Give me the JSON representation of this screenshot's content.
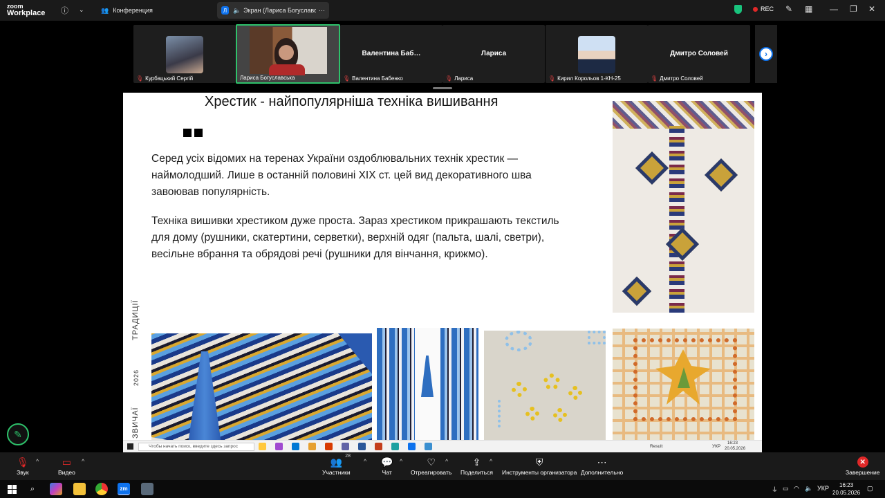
{
  "app": {
    "logo_line1": "zoom",
    "logo_line2": "Workplace",
    "tab_meeting": "Конференция",
    "tab_share_badge": "Л",
    "tab_share": "Экран (Лариса Богуславськ",
    "rec_label": "REC"
  },
  "participants": [
    {
      "name": "Курбацький Сергій",
      "label": ""
    },
    {
      "name": "Лариса Богуславська",
      "label": ""
    },
    {
      "name": "Валентина Бабенко",
      "label": "Валентина  Баб…"
    },
    {
      "name": "Лариса",
      "label": "Лариса"
    },
    {
      "name": "Кирил Корольов 1-КН-25",
      "label": ""
    },
    {
      "name": "Дмитро Соловей",
      "label": "Дмитро Соловей"
    }
  ],
  "slide": {
    "title": "Хрестик - найпопулярніша техніка вишивання",
    "paragraph1": "Серед усіх відомих на теренах України оздоблювальних технік хрестик — наймолодший. Лише в останній половині XIX ст. цей вид декоративного шва завоював популярність.",
    "paragraph2": "Техніка вишивки хрестиком дуже проста. Зараз хрестиком прикрашають текстиль для дому (рушники, скатертини, серветки), верхній одяг (пальта, шалі, светри), весільне вбрання та обрядові речі (рушники для вінчання, крижмо).",
    "vertical_1": "ТРАДИЦІЇ",
    "vertical_2": "2026",
    "vertical_3": "ЗВИЧАЇ"
  },
  "inner_taskbar": {
    "search_placeholder": "Чтобы начать поиск, введите здесь запрос",
    "result": "Result",
    "lang": "УКР",
    "time": "16:23",
    "date": "20.05.2026"
  },
  "controls": {
    "audio": "Звук",
    "video": "Видео",
    "participants": "Участники",
    "participants_count": "28",
    "chat": "Чат",
    "react": "Отреагировать",
    "share": "Поделиться",
    "host_tools": "Инструменты организатора",
    "more": "Дополнительно",
    "end": "Завершение"
  },
  "os_taskbar": {
    "zoom_badge": "zm",
    "lang": "УКР",
    "time": "16:23",
    "date": "20.05.2026"
  },
  "colors": {
    "accent_green": "#2ec26b",
    "zoom_blue": "#0e72ed",
    "end_red": "#e02828"
  }
}
